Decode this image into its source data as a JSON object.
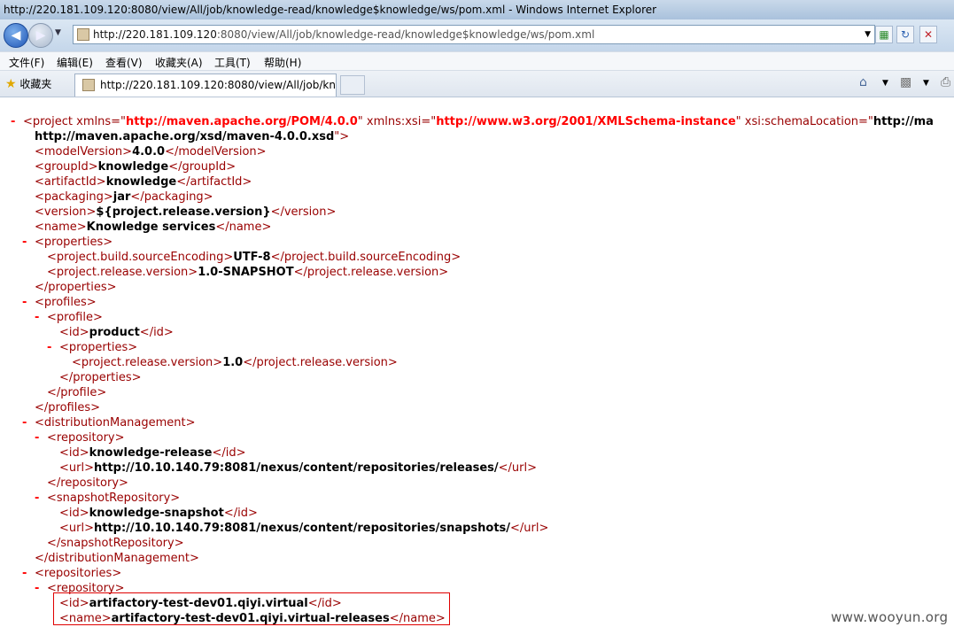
{
  "window": {
    "title": "http://220.181.109.120:8080/view/All/job/knowledge-read/knowledge$knowledge/ws/pom.xml - Windows Internet Explorer"
  },
  "address": {
    "host": "http://220.181.109.120",
    "rest": ":8080/view/All/job/knowledge-read/knowledge$knowledge/ws/pom.xml"
  },
  "menu": [
    "文件(F)",
    "编辑(E)",
    "查看(V)",
    "收藏夹(A)",
    "工具(T)",
    "帮助(H)"
  ],
  "favorites_label": "收藏夹",
  "tab": {
    "title": "http://220.181.109.120:8080/view/All/job/kno..."
  },
  "xml": {
    "project_open_tag": "project",
    "attr_xmlns": "xmlns",
    "val_xmlns": "http://maven.apache.org/POM/4.0.0",
    "attr_xsi": "xmlns:xsi",
    "val_xsi": "http://www.w3.org/2001/XMLSchema-instance",
    "attr_schema": "xsi:schemaLocation",
    "val_schema_start": "http://ma",
    "val_schema_cont": "http://maven.apache.org/xsd/maven-4.0.0.xsd",
    "modelVersion": "4.0.0",
    "groupId": "knowledge",
    "artifactId": "knowledge",
    "packaging": "jar",
    "version": "${project.release.version}",
    "name": "Knowledge services",
    "sourceEncoding": "UTF-8",
    "releaseVersion": "1.0-SNAPSHOT",
    "profile_id": "product",
    "profile_release": "1.0",
    "dist_repo_id": "knowledge-release",
    "dist_repo_url": "http://10.10.140.79:8081/nexus/content/repositories/releases/",
    "snap_repo_id": "knowledge-snapshot",
    "snap_repo_url": "http://10.10.140.79:8081/nexus/content/repositories/snapshots/",
    "repo_id": "artifactory-test-dev01.qiyi.virtual",
    "repo_name": "artifactory-test-dev01.qiyi.virtual-releases"
  },
  "watermark": "www.wooyun.org"
}
